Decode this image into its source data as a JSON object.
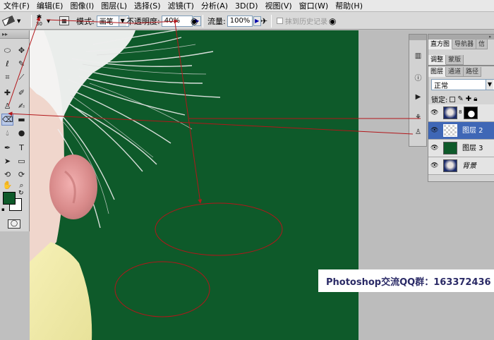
{
  "menu": {
    "items": [
      "文件(F)",
      "编辑(E)",
      "图像(I)",
      "图层(L)",
      "选择(S)",
      "滤镜(T)",
      "分析(A)",
      "3D(D)",
      "视图(V)",
      "窗口(W)",
      "帮助(H)"
    ]
  },
  "options": {
    "brush_size": "30",
    "mode_label": "模式:",
    "mode_value": "画笔",
    "opacity_label": "不透明度:",
    "opacity_value": "40%",
    "flow_label": "流量:",
    "flow_value": "100%",
    "erase_history_label": "抹到历史记录"
  },
  "panels": {
    "top_tabs": [
      "直方图",
      "导航器",
      "信"
    ],
    "adjust_tabs": [
      "调整",
      "蒙版"
    ],
    "layer_tabs": [
      "图层",
      "通道",
      "路径"
    ],
    "blend_mode": "正常",
    "lock_label": "锁定:"
  },
  "layers": [
    {
      "name": "",
      "thumb": "photo",
      "mask": true,
      "selected": false
    },
    {
      "name": "图层 2",
      "thumb": "transparent",
      "mask": false,
      "selected": true
    },
    {
      "name": "图层 3",
      "thumb": "green",
      "mask": false,
      "selected": false
    },
    {
      "name": "背景",
      "thumb": "photo",
      "mask": false,
      "selected": false
    }
  ],
  "watermark": {
    "text": "Photoshop交流QQ群：163372436"
  },
  "colors": {
    "canvas_green": "#0e5a2a",
    "annotation_red": "#b2161a",
    "selected_layer": "#3f67b6"
  }
}
